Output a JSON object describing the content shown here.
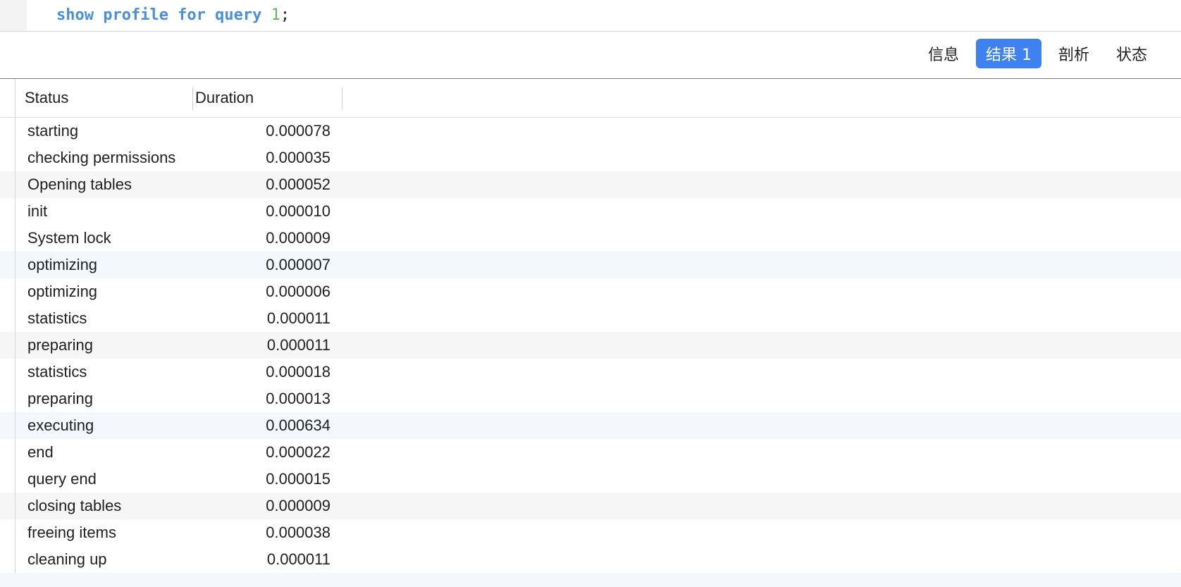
{
  "editor": {
    "sql_keywords": "show profile for query",
    "sql_number": "1",
    "sql_end": ";"
  },
  "tabs": [
    {
      "label": "信息",
      "active": false
    },
    {
      "label": "结果 1",
      "active": true
    },
    {
      "label": "剖析",
      "active": false
    },
    {
      "label": "状态",
      "active": false
    }
  ],
  "table": {
    "columns": [
      "Status",
      "Duration"
    ],
    "rows": [
      [
        "starting",
        "0.000078"
      ],
      [
        "checking permissions",
        "0.000035"
      ],
      [
        "Opening tables",
        "0.000052"
      ],
      [
        "init",
        "0.000010"
      ],
      [
        "System lock",
        "0.000009"
      ],
      [
        "optimizing",
        "0.000007"
      ],
      [
        "optimizing",
        "0.000006"
      ],
      [
        "statistics",
        "0.000011"
      ],
      [
        "preparing",
        "0.000011"
      ],
      [
        "statistics",
        "0.000018"
      ],
      [
        "preparing",
        "0.000013"
      ],
      [
        "executing",
        "0.000634"
      ],
      [
        "end",
        "0.000022"
      ],
      [
        "query end",
        "0.000015"
      ],
      [
        "closing tables",
        "0.000009"
      ],
      [
        "freeing items",
        "0.000038"
      ],
      [
        "cleaning up",
        "0.000011"
      ]
    ]
  },
  "colors": {
    "accent": "#3d82f0",
    "keyword": "#4a90d9",
    "number": "#5cb85c"
  }
}
